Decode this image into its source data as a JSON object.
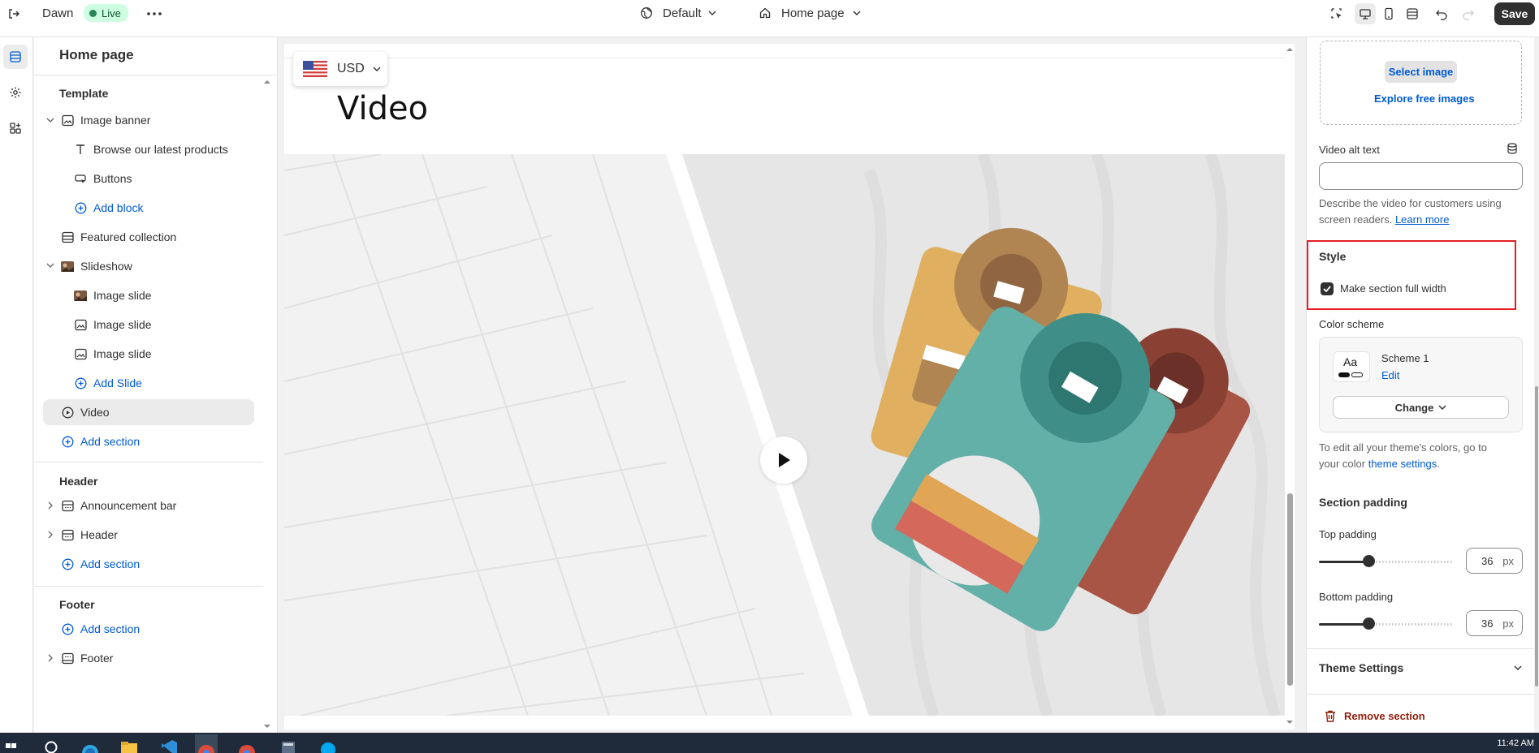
{
  "topbar": {
    "store_name": "Dawn",
    "live_badge": "Live",
    "theme_selector": "Default",
    "page_selector": "Home page",
    "save_label": "Save"
  },
  "sidebar": {
    "title": "Home page",
    "template_label": "Template",
    "items": [
      {
        "label": "Image banner"
      },
      {
        "label": "Browse our latest products"
      },
      {
        "label": "Buttons"
      },
      {
        "label": "Add block"
      },
      {
        "label": "Featured collection"
      },
      {
        "label": "Slideshow"
      },
      {
        "label": "Image slide"
      },
      {
        "label": "Image slide"
      },
      {
        "label": "Image slide"
      },
      {
        "label": "Add Slide"
      },
      {
        "label": "Video"
      },
      {
        "label": "Add section"
      }
    ],
    "header_group": "Header",
    "header_items": [
      {
        "label": "Announcement bar"
      },
      {
        "label": "Header"
      },
      {
        "label": "Add section"
      }
    ],
    "footer_group": "Footer",
    "footer_items": [
      {
        "label": "Add section"
      },
      {
        "label": "Footer"
      }
    ]
  },
  "preview": {
    "currency": "USD",
    "heading": "Video"
  },
  "settings": {
    "select_image": "Select image",
    "explore_images": "Explore free images",
    "video_alt_label": "Video alt text",
    "video_alt_value": "",
    "alt_help_1": "Describe the video for customers using",
    "alt_help_2": "screen readers.",
    "learn_more": "Learn more",
    "style_heading": "Style",
    "full_width_label": "Make section full width",
    "full_width_checked": true,
    "color_scheme_label": "Color scheme",
    "scheme_swatch": "Aa",
    "scheme_name": "Scheme 1",
    "scheme_edit": "Edit",
    "change_label": "Change",
    "theme_help_1": "To edit all your theme's colors, go to",
    "theme_help_2": "your color",
    "theme_settings_link": "theme settings",
    "theme_help_end": ".",
    "padding_heading": "Section padding",
    "top_padding_label": "Top padding",
    "top_padding_value": "36",
    "bottom_padding_label": "Bottom padding",
    "bottom_padding_value": "36",
    "unit": "px",
    "top_padding_fraction": 0.36,
    "bottom_padding_fraction": 0.36,
    "theme_settings_heading": "Theme Settings",
    "remove_section": "Remove section"
  },
  "taskbar": {
    "clock": "11:42 AM"
  },
  "colors": {
    "accent_blue": "#005bd3",
    "live_green": "#29845a",
    "remove_red": "#8e1f0b",
    "highlight_red": "#e51c23"
  }
}
